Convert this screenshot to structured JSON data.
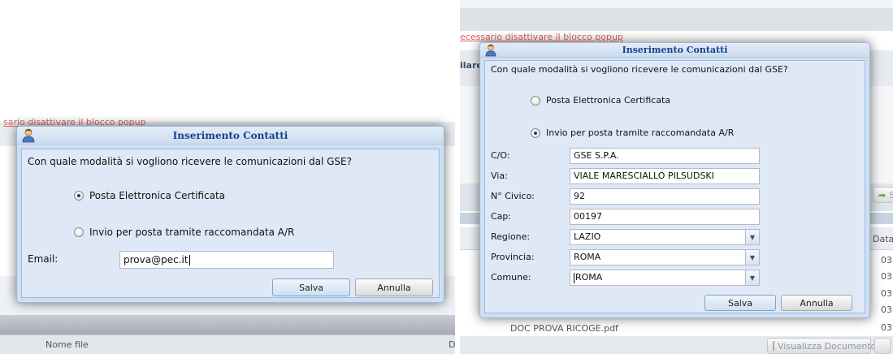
{
  "left": {
    "popup_warning": "sario disattivare il blocco popup",
    "table_header": "Nome file",
    "table_header_edge": "D",
    "dialog": {
      "title": "Inserimento Contatti",
      "question": "Con quale modalità si vogliono ricevere le comunicazioni dal GSE?",
      "options": [
        {
          "label": "Posta Elettronica Certificata",
          "checked": true
        },
        {
          "label": "Invio per posta tramite raccomandata A/R",
          "checked": false
        }
      ],
      "email_label": "Email:",
      "email_value": "prova@pec.it",
      "save_label": "Salva",
      "cancel_label": "Annulla"
    }
  },
  "right": {
    "popup_warning": "ecessario disattivare il blocco popup",
    "bg_fragment": "ilare",
    "bg_button_fragment": "S",
    "bg_column_header": "Data",
    "bg_row_values": [
      "03",
      "03",
      "03",
      "03",
      "03"
    ],
    "bg_file_name": "DOC PROVA RICOGE.pdf",
    "bg_view_button": "Visualizza Documento",
    "dialog": {
      "title": "Inserimento Contatti",
      "question": "Con quale modalità si vogliono ricevere le comunicazioni dal GSE?",
      "options": [
        {
          "label": "Posta Elettronica Certificata",
          "checked": false
        },
        {
          "label": "Invio per posta tramite raccomandata A/R",
          "checked": true
        }
      ],
      "fields": [
        {
          "label": "C/O:",
          "value": "GSE S.P.A."
        },
        {
          "label": "Via:",
          "value": "VIALE MARESCIALLO PILSUDSKI"
        },
        {
          "label": "N° Civico:",
          "value": "92"
        },
        {
          "label": "Cap:",
          "value": "00197"
        }
      ],
      "selects": [
        {
          "label": "Regione:",
          "value": "LAZIO"
        },
        {
          "label": "Provincia:",
          "value": "ROMA"
        },
        {
          "label": "Comune:",
          "value": "ROMA"
        }
      ],
      "save_label": "Salva",
      "cancel_label": "Annulla"
    }
  },
  "colors": {
    "dialog_title": "#15428b",
    "dialog_body": "#dfe8f6",
    "popup_warning": "#e06060"
  }
}
